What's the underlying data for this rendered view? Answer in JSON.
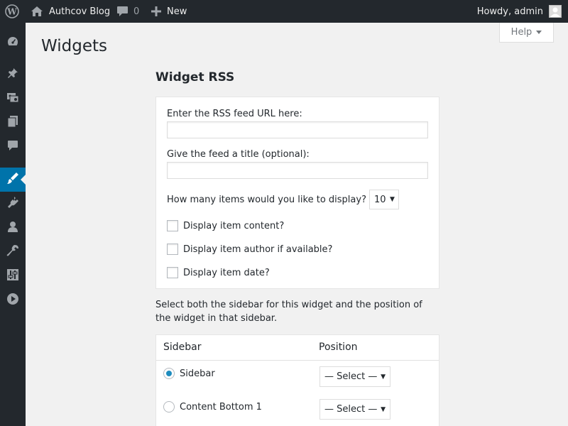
{
  "adminbar": {
    "site_name": "Authcov Blog",
    "comments_count": "0",
    "new_label": "New",
    "howdy": "Howdy, admin"
  },
  "menu": {
    "icons": [
      "dashboard-icon",
      "posts-pin-icon",
      "media-icon",
      "pages-icon",
      "comments-icon",
      "appearance-brush-icon",
      "plugins-icon",
      "users-icon",
      "tools-wrench-icon",
      "settings-sliders-icon",
      "video-play-icon"
    ],
    "current": "appearance-brush-icon"
  },
  "help_label": "Help",
  "page_title": "Widgets",
  "widget": {
    "title": "Widget RSS",
    "url_label": "Enter the RSS feed URL here:",
    "url_value": "",
    "feed_title_label": "Give the feed a title (optional):",
    "feed_title_value": "",
    "items_label": "How many items would you like to display?",
    "items_value": "10",
    "checkboxes": [
      {
        "label": "Display item content?",
        "checked": false
      },
      {
        "label": "Display item author if available?",
        "checked": false
      },
      {
        "label": "Display item date?",
        "checked": false
      }
    ]
  },
  "description": "Select both the sidebar for this widget and the position of the widget in that sidebar.",
  "sidebar_table": {
    "col_sidebar": "Sidebar",
    "col_position": "Position",
    "rows": [
      {
        "label": "Sidebar",
        "selected": true,
        "position": "— Select —"
      },
      {
        "label": "Content Bottom 1",
        "selected": false,
        "position": "— Select —"
      }
    ]
  },
  "colors": {
    "adminbar_bg": "#23282d",
    "accent": "#0073aa",
    "page_bg": "#f1f1f1"
  }
}
